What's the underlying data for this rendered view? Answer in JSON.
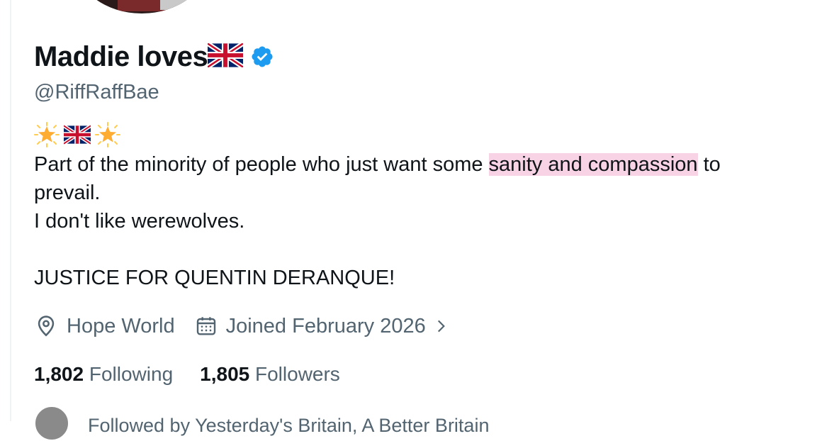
{
  "profile": {
    "display_name": "Maddie loves",
    "handle": "@RiffRaffBae",
    "bio": {
      "line1_pre": "Part of the minority of people who just want some ",
      "line1_highlight": "sanity and compassion",
      "line1_post": " to",
      "line2": "prevail.",
      "line3": "I don't like werewolves.",
      "line4": "JUSTICE FOR QUENTIN DERANQUE!"
    },
    "location": "Hope World",
    "joined": "Joined February 2026",
    "following_count": "1,802",
    "following_label": "Following",
    "followers_count": "1,805",
    "followers_label": "Followers",
    "followed_by": "Followed by Yesterday's Britain, A Better Britain"
  },
  "icons": {
    "name_flag": "uk-flag-icon",
    "verified": "verified-badge-icon",
    "bio_emoji": [
      "glowing-star-icon",
      "uk-flag-icon",
      "glowing-star-icon"
    ],
    "location": "location-pin-icon",
    "joined": "calendar-icon",
    "chevron": "chevron-right-icon"
  },
  "colors": {
    "text": "#0f1419",
    "secondary": "#536471",
    "verified": "#1d9bf0",
    "highlight": "#f8d3e6"
  }
}
